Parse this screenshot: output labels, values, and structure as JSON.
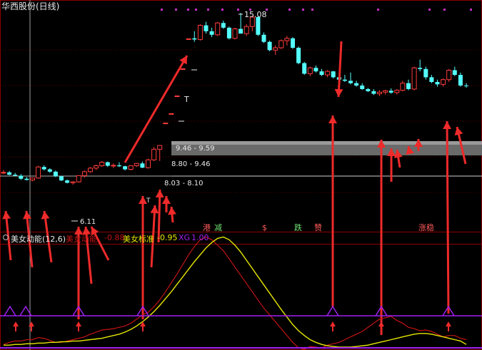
{
  "header": {
    "title": "华西股份(日线)"
  },
  "indicator": {
    "name": "美女动能(12,6)",
    "line1_label": "美女动能",
    "line1_value": "-0.88",
    "line2_label": "美女标准",
    "line2_value": "-0.95",
    "line3_label": "XG",
    "line3_value": "1.00"
  },
  "colors": {
    "up": "#ff3c3c",
    "down": "#54ffff",
    "ma": "#ffff00",
    "signal": "#a020f0",
    "bg": "#000000",
    "grid": "#8b0000"
  },
  "chart_data": [
    {
      "type": "candlestick",
      "title": "华西股份(日线)",
      "annotations": [
        "15.08",
        "6.11",
        "9.46 - 9.59",
        "8.80 - 9.46",
        "8.03 - 8.10"
      ],
      "ohlc": [
        [
          8.3,
          8.42,
          8.25,
          8.32
        ],
        [
          8.32,
          8.38,
          8.2,
          8.22
        ],
        [
          8.22,
          8.3,
          8.15,
          8.18
        ],
        [
          8.18,
          8.25,
          8.0,
          8.05
        ],
        [
          8.05,
          8.12,
          7.98,
          8.0
        ],
        [
          8.0,
          8.1,
          7.95,
          8.08
        ],
        [
          8.08,
          8.6,
          8.05,
          8.55
        ],
        [
          8.55,
          8.62,
          8.4,
          8.45
        ],
        [
          8.45,
          8.5,
          8.3,
          8.35
        ],
        [
          8.35,
          8.4,
          8.12,
          8.15
        ],
        [
          8.15,
          8.18,
          7.95,
          7.98
        ],
        [
          7.98,
          8.02,
          7.85,
          7.88
        ],
        [
          7.88,
          7.95,
          7.8,
          7.92
        ],
        [
          7.92,
          8.2,
          7.88,
          8.18
        ],
        [
          8.18,
          8.4,
          8.1,
          8.35
        ],
        [
          8.35,
          8.55,
          8.3,
          8.5
        ],
        [
          8.5,
          8.65,
          8.42,
          8.6
        ],
        [
          8.6,
          8.8,
          8.55,
          8.75
        ],
        [
          8.75,
          8.78,
          8.55,
          8.6
        ],
        [
          8.6,
          8.7,
          8.5,
          8.62
        ],
        [
          8.62,
          8.75,
          8.55,
          8.58
        ],
        [
          8.58,
          8.6,
          8.4,
          8.45
        ],
        [
          8.45,
          8.62,
          8.4,
          8.6
        ],
        [
          8.6,
          8.72,
          8.55,
          8.7
        ],
        [
          8.7,
          8.78,
          8.5,
          8.52
        ],
        [
          8.52,
          8.9,
          8.48,
          8.85
        ],
        [
          8.85,
          9.4,
          8.8,
          9.3
        ],
        [
          9.3,
          9.48,
          8.8,
          9.46
        ],
        [
          10.4,
          10.41,
          10.4,
          10.41
        ],
        [
          10.8,
          10.81,
          10.8,
          10.81
        ],
        [
          11.55,
          11.56,
          11.55,
          11.56
        ],
        [
          12.7,
          12.71,
          12.7,
          12.71
        ],
        [
          13.97,
          13.98,
          13.97,
          13.98
        ],
        [
          14.0,
          14.3,
          13.85,
          13.95
        ],
        [
          13.95,
          14.6,
          13.9,
          14.55
        ],
        [
          14.55,
          14.7,
          14.2,
          14.3
        ],
        [
          14.3,
          14.45,
          14.05,
          14.15
        ],
        [
          14.15,
          14.7,
          14.1,
          14.65
        ],
        [
          14.65,
          14.75,
          14.4,
          14.45
        ],
        [
          14.45,
          14.5,
          13.95,
          14.0
        ],
        [
          14.0,
          14.45,
          13.95,
          14.4
        ],
        [
          14.4,
          15.08,
          14.35,
          14.2
        ],
        [
          14.2,
          14.6,
          14.1,
          14.5
        ],
        [
          14.5,
          14.95,
          14.3,
          14.9
        ],
        [
          14.9,
          14.95,
          14.1,
          14.15
        ],
        [
          14.15,
          14.25,
          13.8,
          13.85
        ],
        [
          13.85,
          13.9,
          13.45,
          13.5
        ],
        [
          13.5,
          13.7,
          13.3,
          13.6
        ],
        [
          13.6,
          13.95,
          13.55,
          13.9
        ],
        [
          13.9,
          14.1,
          13.7,
          14.0
        ],
        [
          14.0,
          14.05,
          13.55,
          13.6
        ],
        [
          13.6,
          13.65,
          12.9,
          12.95
        ],
        [
          12.95,
          13.0,
          12.45,
          12.5
        ],
        [
          12.5,
          12.8,
          12.4,
          12.75
        ],
        [
          12.75,
          12.85,
          12.55,
          12.6
        ],
        [
          12.6,
          12.7,
          12.4,
          12.45
        ],
        [
          12.45,
          12.65,
          12.35,
          12.6
        ],
        [
          12.6,
          12.62,
          12.3,
          12.35
        ],
        [
          12.35,
          12.4,
          12.2,
          12.25
        ],
        [
          12.25,
          12.45,
          12.15,
          12.2
        ],
        [
          12.2,
          12.55,
          12.05,
          12.1
        ],
        [
          12.1,
          12.2,
          11.95,
          12.0
        ],
        [
          12.0,
          12.1,
          11.82,
          11.85
        ],
        [
          11.85,
          11.9,
          11.72,
          11.76
        ],
        [
          11.76,
          11.85,
          11.6,
          11.65
        ],
        [
          11.65,
          11.8,
          11.55,
          11.72
        ],
        [
          11.72,
          11.82,
          11.62,
          11.78
        ],
        [
          11.78,
          11.88,
          11.65,
          11.7
        ],
        [
          11.7,
          11.85,
          11.62,
          11.8
        ],
        [
          11.8,
          12.2,
          11.75,
          12.1
        ],
        [
          12.1,
          12.25,
          11.8,
          11.85
        ],
        [
          11.85,
          12.8,
          11.8,
          12.75
        ],
        [
          12.75,
          13.1,
          12.6,
          12.7
        ],
        [
          12.7,
          12.8,
          12.25,
          12.35
        ],
        [
          12.35,
          12.45,
          12.1,
          12.15
        ],
        [
          12.15,
          12.25,
          11.95,
          12.05
        ],
        [
          12.05,
          12.3,
          11.95,
          12.25
        ],
        [
          12.25,
          12.7,
          12.15,
          12.65
        ],
        [
          12.65,
          12.8,
          12.4,
          12.45
        ],
        [
          12.45,
          12.55,
          11.95,
          12.0
        ],
        [
          12.0,
          12.1,
          11.9,
          11.98
        ]
      ]
    },
    {
      "type": "line",
      "title": "美女动能(12,6)",
      "series": [
        {
          "name": "美女动能",
          "color": "#c41414",
          "values": [
            -0.95,
            -0.92,
            -0.9,
            -0.9,
            -0.88,
            -0.88,
            -0.85,
            -0.86,
            -0.89,
            -0.92,
            -0.92,
            -0.9,
            -0.88,
            -0.86,
            -0.84,
            -0.8,
            -0.77,
            -0.74,
            -0.73,
            -0.72,
            -0.7,
            -0.68,
            -0.64,
            -0.58,
            -0.52,
            -0.48,
            -0.4,
            -0.3,
            -0.18,
            -0.05,
            0.08,
            0.22,
            0.36,
            0.48,
            0.58,
            0.62,
            0.58,
            0.5,
            0.42,
            0.3,
            0.18,
            0.06,
            -0.06,
            -0.18,
            -0.3,
            -0.42,
            -0.52,
            -0.62,
            -0.72,
            -0.82,
            -0.92,
            -1.0,
            -1.02,
            -0.98,
            -0.99,
            -1.0,
            -0.96,
            -0.94,
            -0.92,
            -0.88,
            -0.84,
            -0.8,
            -0.76,
            -0.7,
            -0.64,
            -0.58,
            -0.56,
            -0.54,
            -0.6,
            -0.64,
            -0.7,
            -0.72,
            -0.75,
            -0.74,
            -0.76,
            -0.8,
            -0.84,
            -0.82,
            -0.82,
            -0.86,
            -0.88
          ]
        },
        {
          "name": "美女标准",
          "color": "#e6e600",
          "values": [
            -0.96,
            -0.96,
            -0.95,
            -0.95,
            -0.94,
            -0.94,
            -0.93,
            -0.93,
            -0.92,
            -0.92,
            -0.91,
            -0.91,
            -0.9,
            -0.9,
            -0.89,
            -0.88,
            -0.87,
            -0.86,
            -0.84,
            -0.82,
            -0.8,
            -0.77,
            -0.73,
            -0.68,
            -0.62,
            -0.55,
            -0.47,
            -0.38,
            -0.28,
            -0.18,
            -0.07,
            0.04,
            0.15,
            0.26,
            0.36,
            0.46,
            0.54,
            0.6,
            0.62,
            0.58,
            0.5,
            0.4,
            0.28,
            0.16,
            0.04,
            -0.08,
            -0.2,
            -0.32,
            -0.44,
            -0.55,
            -0.66,
            -0.75,
            -0.82,
            -0.88,
            -0.92,
            -0.95,
            -0.97,
            -0.98,
            -0.99,
            -0.99,
            -0.99,
            -0.98,
            -0.97,
            -0.96,
            -0.94,
            -0.92,
            -0.9,
            -0.88,
            -0.86,
            -0.84,
            -0.82,
            -0.8,
            -0.79,
            -0.79,
            -0.8,
            -0.82,
            -0.84,
            -0.86,
            -0.88,
            -0.9,
            -0.95
          ]
        },
        {
          "name": "XG",
          "color": "#a020f0",
          "values": [
            0,
            0,
            0,
            0,
            0,
            0,
            0,
            0,
            0,
            0,
            0,
            0,
            0,
            0,
            0,
            0,
            0,
            0,
            0,
            0,
            0,
            0,
            0,
            0,
            0,
            0,
            0,
            0,
            0,
            0,
            0,
            0,
            0,
            0,
            0,
            0,
            0,
            0,
            0,
            0,
            0,
            0,
            0,
            0,
            0,
            0,
            0,
            0,
            0,
            0,
            0,
            0,
            0,
            0,
            0,
            0,
            0,
            0,
            0,
            0,
            0,
            0,
            0,
            0,
            0,
            0,
            0,
            0,
            0,
            0,
            0,
            0,
            0,
            0,
            0,
            0,
            0,
            0,
            0,
            0,
            1
          ]
        }
      ],
      "text_signals": [
        "港",
        "减",
        "$",
        "跌",
        "赞",
        "涨稳"
      ]
    }
  ]
}
